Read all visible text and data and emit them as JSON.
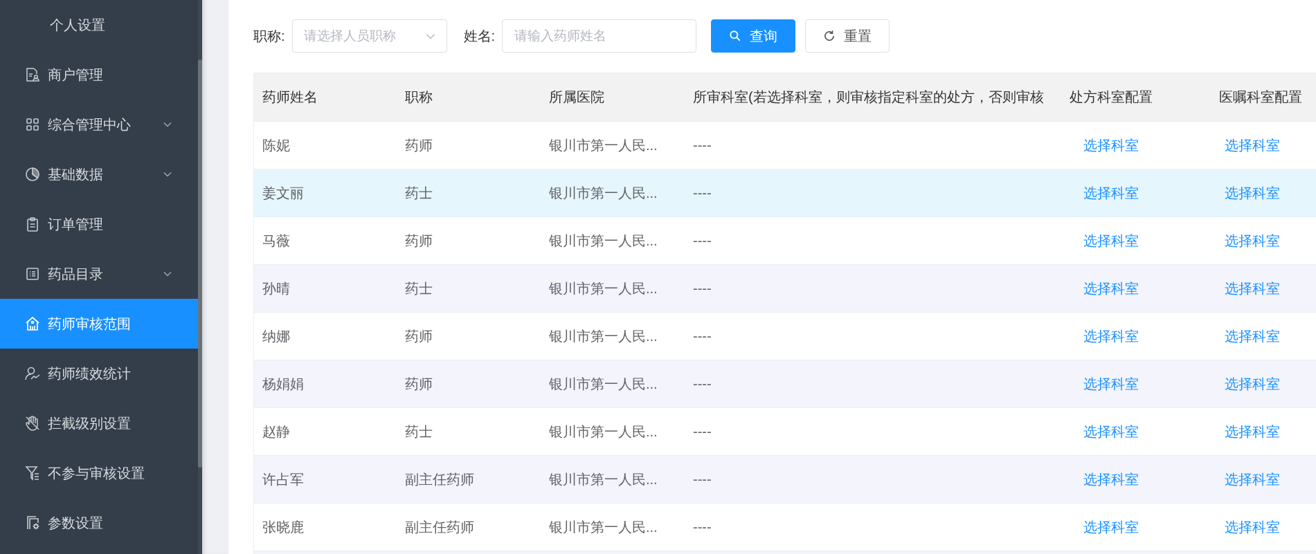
{
  "sidebar": {
    "items": [
      {
        "label": "个人设置",
        "expandable": false,
        "selected": false
      },
      {
        "label": "商户管理",
        "expandable": false,
        "selected": false
      },
      {
        "label": "综合管理中心",
        "expandable": true,
        "selected": false
      },
      {
        "label": "基础数据",
        "expandable": true,
        "selected": false
      },
      {
        "label": "订单管理",
        "expandable": false,
        "selected": false
      },
      {
        "label": "药品目录",
        "expandable": true,
        "selected": false
      },
      {
        "label": "药师审核范围",
        "expandable": false,
        "selected": true
      },
      {
        "label": "药师绩效统计",
        "expandable": false,
        "selected": false
      },
      {
        "label": "拦截级别设置",
        "expandable": false,
        "selected": false
      },
      {
        "label": "不参与审核设置",
        "expandable": false,
        "selected": false
      },
      {
        "label": "参数设置",
        "expandable": false,
        "selected": false
      }
    ]
  },
  "filters": {
    "title_label": "职称:",
    "title_placeholder": "请选择人员职称",
    "name_label": "姓名:",
    "name_placeholder": "请输入药师姓名",
    "search_button": "查询",
    "reset_button": "重置"
  },
  "table": {
    "columns": [
      "药师姓名",
      "职称",
      "所属医院",
      "所审科室(若选择科室，则审核指定科室的处方，否则审核",
      "处方科室配置",
      "医嘱科室配置"
    ],
    "rows": [
      {
        "name": "陈妮",
        "title": "药师",
        "hospital": "银川市第一人民...",
        "departments": "----",
        "prescription_action": "选择科室",
        "order_action": "选择科室",
        "highlighted": false
      },
      {
        "name": "姜文丽",
        "title": "药士",
        "hospital": "银川市第一人民...",
        "departments": "----",
        "prescription_action": "选择科室",
        "order_action": "选择科室",
        "highlighted": true
      },
      {
        "name": "马薇",
        "title": "药师",
        "hospital": "银川市第一人民...",
        "departments": "----",
        "prescription_action": "选择科室",
        "order_action": "选择科室",
        "highlighted": false
      },
      {
        "name": "孙晴",
        "title": "药士",
        "hospital": "银川市第一人民...",
        "departments": "----",
        "prescription_action": "选择科室",
        "order_action": "选择科室",
        "highlighted": false
      },
      {
        "name": "纳娜",
        "title": "药师",
        "hospital": "银川市第一人民...",
        "departments": "----",
        "prescription_action": "选择科室",
        "order_action": "选择科室",
        "highlighted": false
      },
      {
        "name": "杨娟娟",
        "title": "药师",
        "hospital": "银川市第一人民...",
        "departments": "----",
        "prescription_action": "选择科室",
        "order_action": "选择科室",
        "highlighted": false
      },
      {
        "name": "赵静",
        "title": "药士",
        "hospital": "银川市第一人民...",
        "departments": "----",
        "prescription_action": "选择科室",
        "order_action": "选择科室",
        "highlighted": false
      },
      {
        "name": "许占军",
        "title": "副主任药师",
        "hospital": "银川市第一人民...",
        "departments": "----",
        "prescription_action": "选择科室",
        "order_action": "选择科室",
        "highlighted": false
      },
      {
        "name": "张晓鹿",
        "title": "副主任药师",
        "hospital": "银川市第一人民...",
        "departments": "----",
        "prescription_action": "选择科室",
        "order_action": "选择科室",
        "highlighted": false
      }
    ]
  }
}
